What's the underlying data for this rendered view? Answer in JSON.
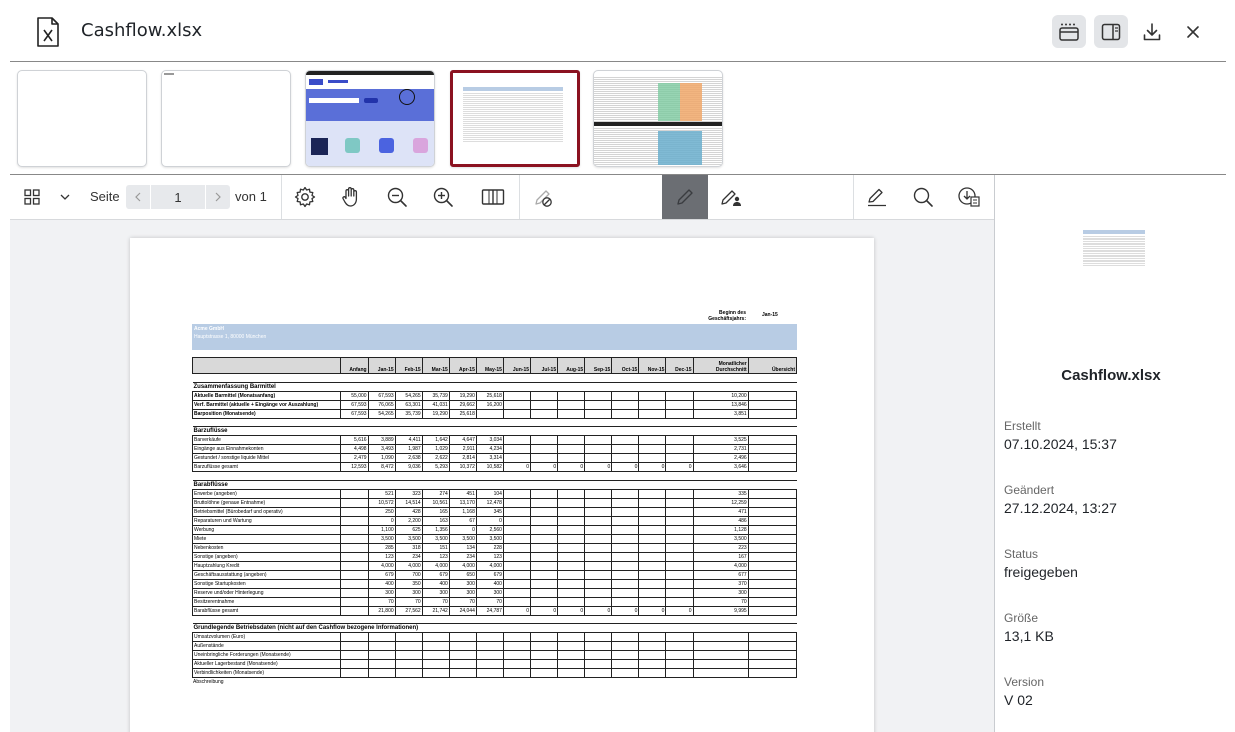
{
  "header": {
    "file_name": "Cashflow.xlsx"
  },
  "toolbar": {
    "seite_label": "Seite",
    "page_value": "1",
    "von_label": "von 1"
  },
  "sidebar": {
    "file_name": "Cashflow.xlsx",
    "props": [
      {
        "label": "Erstellt",
        "value": "07.10.2024, 15:37"
      },
      {
        "label": "Geändert",
        "value": "27.12.2024, 13:27"
      },
      {
        "label": "Status",
        "value": "freigegeben"
      },
      {
        "label": "Größe",
        "value": "13,1 KB"
      },
      {
        "label": "Version",
        "value": "V 02"
      }
    ]
  },
  "sheet": {
    "fy_label": "Beginn des Geschäftsjahrs:",
    "fy_value": "Jan-15",
    "company": "Acme GmbH",
    "address": "Hauptstrasse 1, 80000 München",
    "columns": [
      "",
      "Anfang",
      "Jan-15",
      "Feb-15",
      "Mar-15",
      "Apr-15",
      "May-15",
      "Jun-15",
      "Jul-15",
      "Aug-15",
      "Sep-15",
      "Oct-15",
      "Nov-15",
      "Dec-15",
      "Monatlicher Durchschnitt",
      "Übersicht"
    ],
    "sections": [
      {
        "title": "Zusammenfassung Barmittel",
        "rows": [
          [
            "Aktuelle Barmittel (Monatsanfang)",
            "55,000",
            "67,593",
            "54,265",
            "35,739",
            "19,290",
            "25,618",
            "",
            "",
            "",
            "",
            "",
            "",
            "",
            "10,200",
            ""
          ],
          [
            "Verf. Barmittel (aktuelle + Eingänge vor Auszahlung)",
            "67,593",
            "76,065",
            "63,301",
            "41,031",
            "29,662",
            "16,200",
            "",
            "",
            "",
            "",
            "",
            "",
            "",
            "13,846",
            ""
          ],
          [
            "Barposition (Monatsende)",
            "67,593",
            "54,265",
            "35,739",
            "19,290",
            "25,618",
            "",
            "",
            "",
            "",
            "",
            "",
            "",
            "",
            "3,851",
            ""
          ]
        ]
      },
      {
        "title": "Barzuflüsse",
        "rows": [
          [
            "Barverkäufe",
            "5,616",
            "3,889",
            "4,411",
            "1,642",
            "4,647",
            "3,034",
            "",
            "",
            "",
            "",
            "",
            "",
            "",
            "3,525",
            ""
          ],
          [
            "Eingänge aus Einnahmekonten",
            "4,498",
            "3,493",
            "1,987",
            "1,029",
            "2,911",
            "4,234",
            "",
            "",
            "",
            "",
            "",
            "",
            "",
            "2,731",
            ""
          ],
          [
            "Gestundet / sonstige liquide Mittel",
            "2,479",
            "1,090",
            "2,638",
            "2,622",
            "2,814",
            "3,314",
            "",
            "",
            "",
            "",
            "",
            "",
            "",
            "2,496",
            ""
          ],
          [
            "Barzuflüsse gesamt",
            "12,593",
            "8,472",
            "9,036",
            "5,293",
            "10,372",
            "10,582",
            "0",
            "0",
            "0",
            "0",
            "0",
            "0",
            "0",
            "3,646",
            ""
          ]
        ]
      },
      {
        "title": "Barabflüsse",
        "rows": [
          [
            "Erwerbe (angeben)",
            "",
            "521",
            "323",
            "274",
            "451",
            "104",
            "",
            "",
            "",
            "",
            "",
            "",
            "",
            "335",
            ""
          ],
          [
            "Bruttolöhne (genaue Entnahme)",
            "",
            "10,572",
            "14,514",
            "10,561",
            "13,170",
            "12,478",
            "",
            "",
            "",
            "",
            "",
            "",
            "",
            "12,259",
            ""
          ],
          [
            "Betriebsmittel (Bürobedarf und operativ)",
            "",
            "250",
            "428",
            "165",
            "1,168",
            "345",
            "",
            "",
            "",
            "",
            "",
            "",
            "",
            "471",
            ""
          ],
          [
            "Reparaturen und Wartung",
            "",
            "0",
            "2,200",
            "163",
            "67",
            "0",
            "",
            "",
            "",
            "",
            "",
            "",
            "",
            "486",
            ""
          ],
          [
            "Werbung",
            "",
            "1,100",
            "625",
            "1,356",
            "0",
            "2,560",
            "",
            "",
            "",
            "",
            "",
            "",
            "",
            "1,128",
            ""
          ],
          [
            "Miete",
            "",
            "3,500",
            "3,500",
            "3,500",
            "3,500",
            "3,500",
            "",
            "",
            "",
            "",
            "",
            "",
            "",
            "3,500",
            ""
          ],
          [
            "Nebenkosten",
            "",
            "285",
            "318",
            "151",
            "134",
            "228",
            "",
            "",
            "",
            "",
            "",
            "",
            "",
            "223",
            ""
          ],
          [
            "Sonstige (angeben)",
            "",
            "123",
            "234",
            "123",
            "234",
            "123",
            "",
            "",
            "",
            "",
            "",
            "",
            "",
            "167",
            ""
          ],
          [
            "Hauptzahlung Kredit",
            "",
            "4,000",
            "4,000",
            "4,000",
            "4,000",
            "4,000",
            "",
            "",
            "",
            "",
            "",
            "",
            "",
            "4,000",
            ""
          ],
          [
            "Geschäftsausstattung (angeben)",
            "",
            "679",
            "700",
            "679",
            "650",
            "679",
            "",
            "",
            "",
            "",
            "",
            "",
            "",
            "677",
            ""
          ],
          [
            "Sonstige Startupkosten",
            "",
            "400",
            "350",
            "400",
            "300",
            "400",
            "",
            "",
            "",
            "",
            "",
            "",
            "",
            "370",
            ""
          ],
          [
            "Reserve und/oder Hinterlegung",
            "",
            "300",
            "300",
            "300",
            "300",
            "300",
            "",
            "",
            "",
            "",
            "",
            "",
            "",
            "300",
            ""
          ],
          [
            "Besitzerentnahme",
            "",
            "70",
            "70",
            "70",
            "70",
            "70",
            "",
            "",
            "",
            "",
            "",
            "",
            "",
            "70",
            ""
          ],
          [
            "Barabflüsse gesamt",
            "",
            "21,800",
            "27,562",
            "21,742",
            "24,044",
            "24,787",
            "0",
            "0",
            "0",
            "0",
            "0",
            "0",
            "0",
            "9,995",
            ""
          ]
        ]
      },
      {
        "title": "Grundlegende Betriebsdaten (nicht auf den Cashflow bezogene Informationen)",
        "rows": [
          [
            "Umsatzvolumen (Euro)",
            "",
            "",
            "",
            "",
            "",
            "",
            "",
            "",
            "",
            "",
            "",
            "",
            "",
            "",
            ""
          ],
          [
            "Außenstände",
            "",
            "",
            "",
            "",
            "",
            "",
            "",
            "",
            "",
            "",
            "",
            "",
            "",
            "",
            ""
          ],
          [
            "Uneinbringliche Forderungen (Monatsende)",
            "",
            "",
            "",
            "",
            "",
            "",
            "",
            "",
            "",
            "",
            "",
            "",
            "",
            "",
            ""
          ],
          [
            "Aktueller Lagerbestand (Monatsende)",
            "",
            "",
            "",
            "",
            "",
            "",
            "",
            "",
            "",
            "",
            "",
            "",
            "",
            "",
            ""
          ],
          [
            "Verbindlichkeiten (Monatsende)",
            "",
            "",
            "",
            "",
            "",
            "",
            "",
            "",
            "",
            "",
            "",
            "",
            "",
            "",
            ""
          ]
        ]
      }
    ],
    "footer_row": "Abschreibung"
  }
}
